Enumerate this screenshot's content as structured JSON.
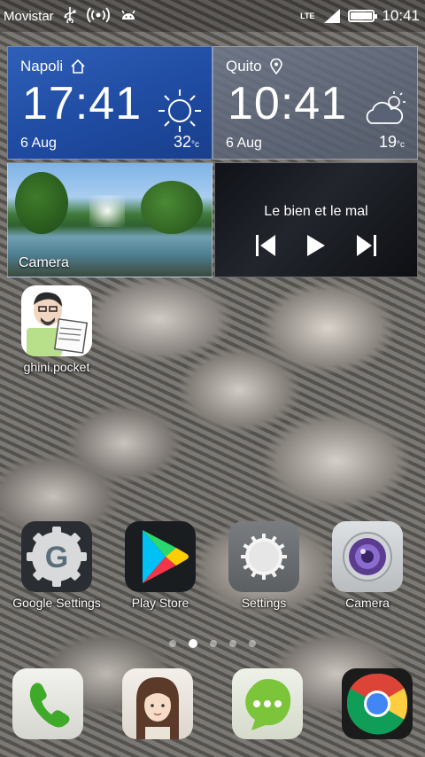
{
  "status_bar": {
    "carrier": "Movistar",
    "network": "LTE",
    "battery_level": 1.0,
    "time": "10:41"
  },
  "clock_widgets": [
    {
      "city": "Napoli",
      "time": "17:41",
      "date": "6 Aug",
      "temp": "32",
      "unit": "°c",
      "weather": "sunny-icon",
      "place_icon": "home-icon"
    },
    {
      "city": "Quito",
      "time": "10:41",
      "date": "6 Aug",
      "temp": "19",
      "unit": "°c",
      "weather": "partly-cloudy-icon",
      "place_icon": "location-pin-icon"
    }
  ],
  "camera_widget": {
    "label": "Camera"
  },
  "music_widget": {
    "song": "Le bien et le mal"
  },
  "apps": [
    {
      "label": "ghini.pocket"
    },
    {
      "label": "Google Settings"
    },
    {
      "label": "Play Store"
    },
    {
      "label": "Settings"
    },
    {
      "label": "Camera"
    }
  ],
  "page_indicator": {
    "pages": 5,
    "current": 2
  },
  "dock": [
    {
      "icon": "phone-icon"
    },
    {
      "icon": "contacts-icon"
    },
    {
      "icon": "messaging-icon"
    },
    {
      "icon": "chrome-icon"
    }
  ],
  "colors": {
    "napoli_widget": "#1e4aa0",
    "quito_widget": "#5a6276"
  }
}
